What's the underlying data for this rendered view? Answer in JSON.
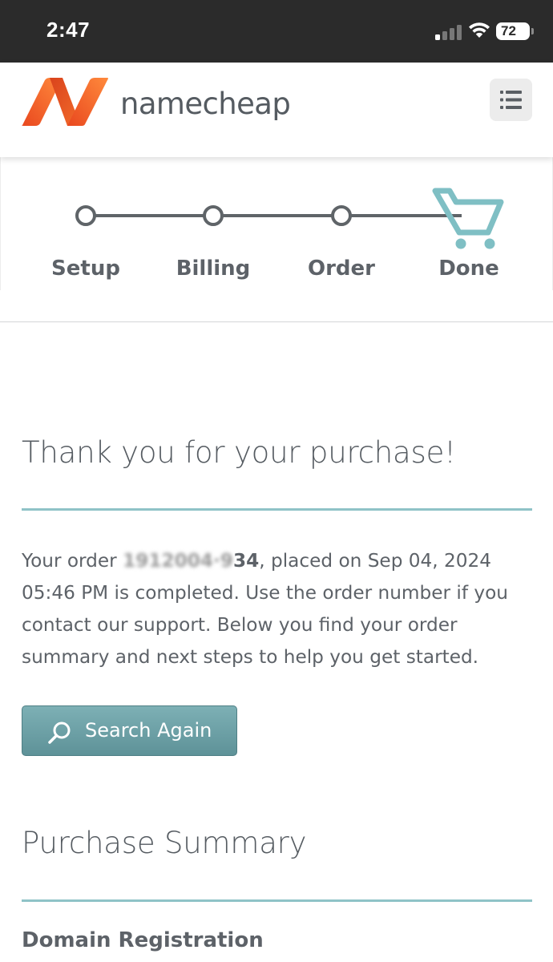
{
  "status_bar": {
    "time": "2:47",
    "battery": "72"
  },
  "header": {
    "logo_text": "namecheap",
    "logo_colors": [
      "#f06a29",
      "#e14d21",
      "#ff8a3c"
    ],
    "menu_icon": "list-icon"
  },
  "steps": {
    "items": [
      {
        "label": "Setup"
      },
      {
        "label": "Billing"
      },
      {
        "label": "Order"
      },
      {
        "label": "Done"
      }
    ],
    "current_icon": "cart-icon",
    "accent": "#7fbfc4"
  },
  "main": {
    "title": "Thank you for your purchase!",
    "order_prefix": "Your order ",
    "order_number_visible_part": "34",
    "order_number_blurred_part": "1912004·9",
    "order_suffix": ", placed on Sep 04, 2024 05:46 PM is completed. Use the order number if you contact our support. Below you find your order summary and next steps to help you get started.",
    "search_button": "Search Again",
    "summary_title": "Purchase Summary",
    "domain_registration": "Domain Registration"
  }
}
